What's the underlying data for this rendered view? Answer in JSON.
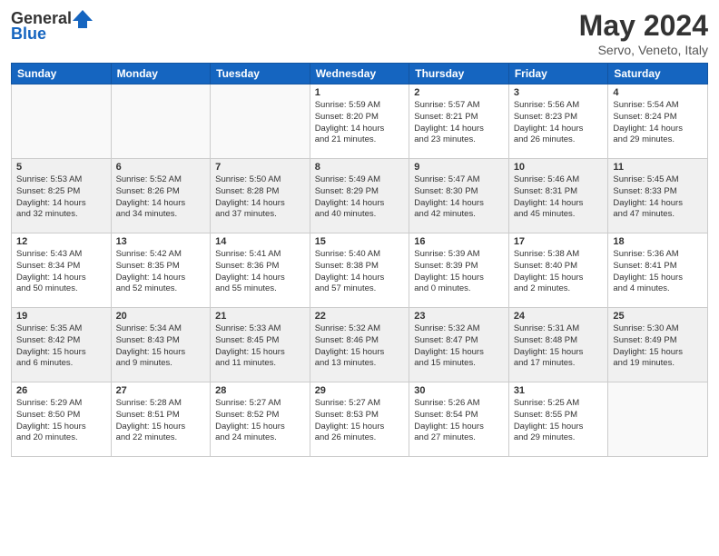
{
  "header": {
    "logo_general": "General",
    "logo_blue": "Blue",
    "title": "May 2024",
    "location": "Servo, Veneto, Italy"
  },
  "weekdays": [
    "Sunday",
    "Monday",
    "Tuesday",
    "Wednesday",
    "Thursday",
    "Friday",
    "Saturday"
  ],
  "weeks": [
    [
      {
        "day": "",
        "info": "",
        "empty": true
      },
      {
        "day": "",
        "info": "",
        "empty": true
      },
      {
        "day": "",
        "info": "",
        "empty": true
      },
      {
        "day": "1",
        "info": "Sunrise: 5:59 AM\nSunset: 8:20 PM\nDaylight: 14 hours\nand 21 minutes."
      },
      {
        "day": "2",
        "info": "Sunrise: 5:57 AM\nSunset: 8:21 PM\nDaylight: 14 hours\nand 23 minutes."
      },
      {
        "day": "3",
        "info": "Sunrise: 5:56 AM\nSunset: 8:23 PM\nDaylight: 14 hours\nand 26 minutes."
      },
      {
        "day": "4",
        "info": "Sunrise: 5:54 AM\nSunset: 8:24 PM\nDaylight: 14 hours\nand 29 minutes."
      }
    ],
    [
      {
        "day": "5",
        "info": "Sunrise: 5:53 AM\nSunset: 8:25 PM\nDaylight: 14 hours\nand 32 minutes.",
        "shaded": true
      },
      {
        "day": "6",
        "info": "Sunrise: 5:52 AM\nSunset: 8:26 PM\nDaylight: 14 hours\nand 34 minutes.",
        "shaded": true
      },
      {
        "day": "7",
        "info": "Sunrise: 5:50 AM\nSunset: 8:28 PM\nDaylight: 14 hours\nand 37 minutes.",
        "shaded": true
      },
      {
        "day": "8",
        "info": "Sunrise: 5:49 AM\nSunset: 8:29 PM\nDaylight: 14 hours\nand 40 minutes.",
        "shaded": true
      },
      {
        "day": "9",
        "info": "Sunrise: 5:47 AM\nSunset: 8:30 PM\nDaylight: 14 hours\nand 42 minutes.",
        "shaded": true
      },
      {
        "day": "10",
        "info": "Sunrise: 5:46 AM\nSunset: 8:31 PM\nDaylight: 14 hours\nand 45 minutes.",
        "shaded": true
      },
      {
        "day": "11",
        "info": "Sunrise: 5:45 AM\nSunset: 8:33 PM\nDaylight: 14 hours\nand 47 minutes.",
        "shaded": true
      }
    ],
    [
      {
        "day": "12",
        "info": "Sunrise: 5:43 AM\nSunset: 8:34 PM\nDaylight: 14 hours\nand 50 minutes."
      },
      {
        "day": "13",
        "info": "Sunrise: 5:42 AM\nSunset: 8:35 PM\nDaylight: 14 hours\nand 52 minutes."
      },
      {
        "day": "14",
        "info": "Sunrise: 5:41 AM\nSunset: 8:36 PM\nDaylight: 14 hours\nand 55 minutes."
      },
      {
        "day": "15",
        "info": "Sunrise: 5:40 AM\nSunset: 8:38 PM\nDaylight: 14 hours\nand 57 minutes."
      },
      {
        "day": "16",
        "info": "Sunrise: 5:39 AM\nSunset: 8:39 PM\nDaylight: 15 hours\nand 0 minutes."
      },
      {
        "day": "17",
        "info": "Sunrise: 5:38 AM\nSunset: 8:40 PM\nDaylight: 15 hours\nand 2 minutes."
      },
      {
        "day": "18",
        "info": "Sunrise: 5:36 AM\nSunset: 8:41 PM\nDaylight: 15 hours\nand 4 minutes."
      }
    ],
    [
      {
        "day": "19",
        "info": "Sunrise: 5:35 AM\nSunset: 8:42 PM\nDaylight: 15 hours\nand 6 minutes.",
        "shaded": true
      },
      {
        "day": "20",
        "info": "Sunrise: 5:34 AM\nSunset: 8:43 PM\nDaylight: 15 hours\nand 9 minutes.",
        "shaded": true
      },
      {
        "day": "21",
        "info": "Sunrise: 5:33 AM\nSunset: 8:45 PM\nDaylight: 15 hours\nand 11 minutes.",
        "shaded": true
      },
      {
        "day": "22",
        "info": "Sunrise: 5:32 AM\nSunset: 8:46 PM\nDaylight: 15 hours\nand 13 minutes.",
        "shaded": true
      },
      {
        "day": "23",
        "info": "Sunrise: 5:32 AM\nSunset: 8:47 PM\nDaylight: 15 hours\nand 15 minutes.",
        "shaded": true
      },
      {
        "day": "24",
        "info": "Sunrise: 5:31 AM\nSunset: 8:48 PM\nDaylight: 15 hours\nand 17 minutes.",
        "shaded": true
      },
      {
        "day": "25",
        "info": "Sunrise: 5:30 AM\nSunset: 8:49 PM\nDaylight: 15 hours\nand 19 minutes.",
        "shaded": true
      }
    ],
    [
      {
        "day": "26",
        "info": "Sunrise: 5:29 AM\nSunset: 8:50 PM\nDaylight: 15 hours\nand 20 minutes."
      },
      {
        "day": "27",
        "info": "Sunrise: 5:28 AM\nSunset: 8:51 PM\nDaylight: 15 hours\nand 22 minutes."
      },
      {
        "day": "28",
        "info": "Sunrise: 5:27 AM\nSunset: 8:52 PM\nDaylight: 15 hours\nand 24 minutes."
      },
      {
        "day": "29",
        "info": "Sunrise: 5:27 AM\nSunset: 8:53 PM\nDaylight: 15 hours\nand 26 minutes."
      },
      {
        "day": "30",
        "info": "Sunrise: 5:26 AM\nSunset: 8:54 PM\nDaylight: 15 hours\nand 27 minutes."
      },
      {
        "day": "31",
        "info": "Sunrise: 5:25 AM\nSunset: 8:55 PM\nDaylight: 15 hours\nand 29 minutes."
      },
      {
        "day": "",
        "info": "",
        "empty": true
      }
    ]
  ]
}
